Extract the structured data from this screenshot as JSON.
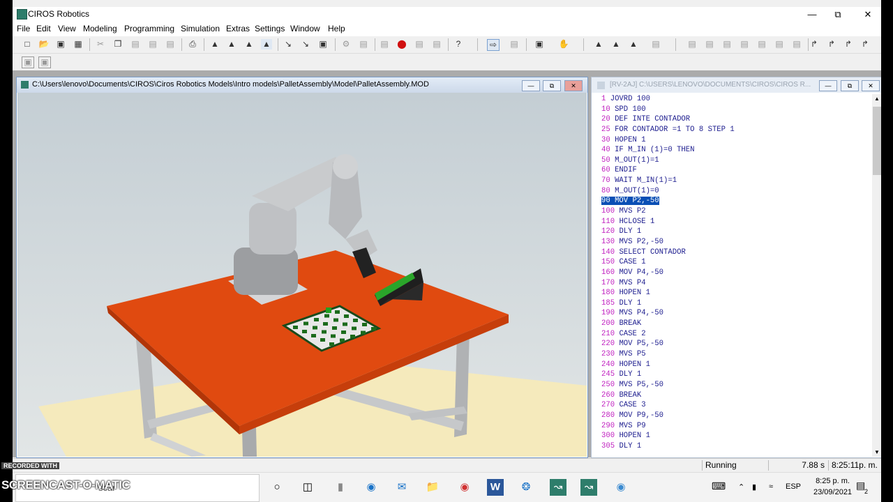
{
  "app": {
    "title": "CIROS Robotics"
  },
  "menu": [
    "File",
    "Edit",
    "View",
    "Modeling",
    "Programming",
    "Simulation",
    "Extras",
    "Settings",
    "Window",
    "Help"
  ],
  "model_window": {
    "path": "C:\\Users\\lenovo\\Documents\\CIROS\\Ciros Robotics Models\\Intro models\\PalletAssembly\\Model\\PalletAssembly.MOD"
  },
  "program_window": {
    "path": "[RV-2AJ] C:\\USERS\\LENOVO\\DOCUMENTS\\CIROS\\CIROS R..."
  },
  "program_lines": [
    {
      "n": "1",
      "code": "JOVRD 100"
    },
    {
      "n": "10",
      "code": "SPD 100"
    },
    {
      "n": "20",
      "code": "DEF INTE CONTADOR"
    },
    {
      "n": "25",
      "code": "FOR CONTADOR =1 TO 8 STEP 1"
    },
    {
      "n": "30",
      "code": "HOPEN 1"
    },
    {
      "n": "40",
      "code": "IF M_IN (1)=0 THEN"
    },
    {
      "n": "50",
      "code": "M_OUT(1)=1"
    },
    {
      "n": "60",
      "code": "ENDIF"
    },
    {
      "n": "70",
      "code": "WAIT M_IN(1)=1"
    },
    {
      "n": "80",
      "code": "M_OUT(1)=0"
    },
    {
      "n": "90",
      "code": "MOV P2,-50",
      "selected": true
    },
    {
      "n": "100",
      "code": "MVS P2"
    },
    {
      "n": "110",
      "code": "HCLOSE 1"
    },
    {
      "n": "120",
      "code": "DLY 1"
    },
    {
      "n": "130",
      "code": "MVS P2,-50"
    },
    {
      "n": "140",
      "code": "SELECT CONTADOR"
    },
    {
      "n": "150",
      "code": "CASE 1"
    },
    {
      "n": "160",
      "code": "MOV P4,-50"
    },
    {
      "n": "170",
      "code": "MVS P4"
    },
    {
      "n": "180",
      "code": "HOPEN 1"
    },
    {
      "n": "185",
      "code": "DLY 1"
    },
    {
      "n": "190",
      "code": "MVS P4,-50"
    },
    {
      "n": "200",
      "code": "BREAK"
    },
    {
      "n": "210",
      "code": "CASE 2"
    },
    {
      "n": "220",
      "code": "MOV P5,-50"
    },
    {
      "n": "230",
      "code": "MVS P5"
    },
    {
      "n": "240",
      "code": "HOPEN 1"
    },
    {
      "n": "245",
      "code": "DLY 1"
    },
    {
      "n": "250",
      "code": "MVS P5,-50"
    },
    {
      "n": "260",
      "code": "BREAK"
    },
    {
      "n": "270",
      "code": "CASE 3"
    },
    {
      "n": "280",
      "code": "MOV P9,-50"
    },
    {
      "n": "290",
      "code": "MVS P9"
    },
    {
      "n": "300",
      "code": "HOPEN 1"
    },
    {
      "n": "305",
      "code": "DLY 1"
    }
  ],
  "status": {
    "state": "Running",
    "elapsed": "7.88 s",
    "clock": "8:25:11p. m."
  },
  "taskbar": {
    "search_text": "scar",
    "language": "ESP",
    "time": "8:25 p. m.",
    "date": "23/09/2021",
    "notification_count": "2"
  },
  "watermark": {
    "recorded": "RECORDED WITH",
    "brand": "SCREENCAST-O-MATIC"
  },
  "colors": {
    "table": "#e04a10",
    "selection": "#0a4fb5",
    "line_number": "#c020c0",
    "keyword": "#202090"
  }
}
